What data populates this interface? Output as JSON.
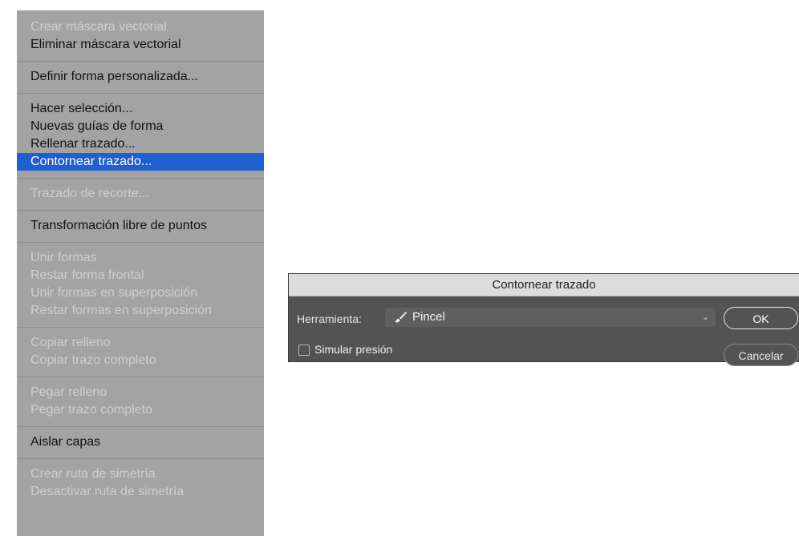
{
  "menu": {
    "groups": [
      {
        "items": [
          {
            "label": "Crear máscara vectorial",
            "disabled": true
          },
          {
            "label": "Eliminar máscara vectorial",
            "disabled": false
          }
        ]
      },
      {
        "items": [
          {
            "label": "Definir forma personalizada...",
            "disabled": false
          }
        ]
      },
      {
        "items": [
          {
            "label": "Hacer selección...",
            "disabled": false
          },
          {
            "label": "Nuevas guías de forma",
            "disabled": false
          },
          {
            "label": "Rellenar trazado...",
            "disabled": false
          },
          {
            "label": "Contornear trazado...",
            "disabled": false,
            "highlighted": true
          }
        ]
      },
      {
        "items": [
          {
            "label": "Trazado de recorte...",
            "disabled": true
          }
        ]
      },
      {
        "items": [
          {
            "label": "Transformación libre de puntos",
            "disabled": false
          }
        ]
      },
      {
        "items": [
          {
            "label": "Unir formas",
            "disabled": true
          },
          {
            "label": "Restar forma frontal",
            "disabled": true
          },
          {
            "label": "Unir formas en superposición",
            "disabled": true
          },
          {
            "label": "Restar formas en superposición",
            "disabled": true
          }
        ]
      },
      {
        "items": [
          {
            "label": "Copiar relleno",
            "disabled": true
          },
          {
            "label": "Copiar trazo completo",
            "disabled": true
          }
        ]
      },
      {
        "items": [
          {
            "label": "Pegar relleno",
            "disabled": true
          },
          {
            "label": "Pegar trazo completo",
            "disabled": true
          }
        ]
      },
      {
        "items": [
          {
            "label": "Aislar capas",
            "disabled": false
          }
        ]
      },
      {
        "items": [
          {
            "label": "Crear ruta de simetría",
            "disabled": true
          },
          {
            "label": "Desactivar ruta de simetría",
            "disabled": true
          }
        ]
      }
    ]
  },
  "dialog": {
    "title": "Contornear trazado",
    "tool_label": "Herramienta:",
    "tool_value": "Pincel",
    "tool_icon": "brush-icon",
    "simulate_pressure_label": "Simular presión",
    "simulate_pressure_checked": false,
    "ok_label": "OK",
    "cancel_label": "Cancelar"
  },
  "colors": {
    "menu_bg": "#a3a3a3",
    "highlight": "#1f5fd0",
    "dialog_bg": "#535353",
    "titlebar_bg": "#dcdcdc"
  }
}
